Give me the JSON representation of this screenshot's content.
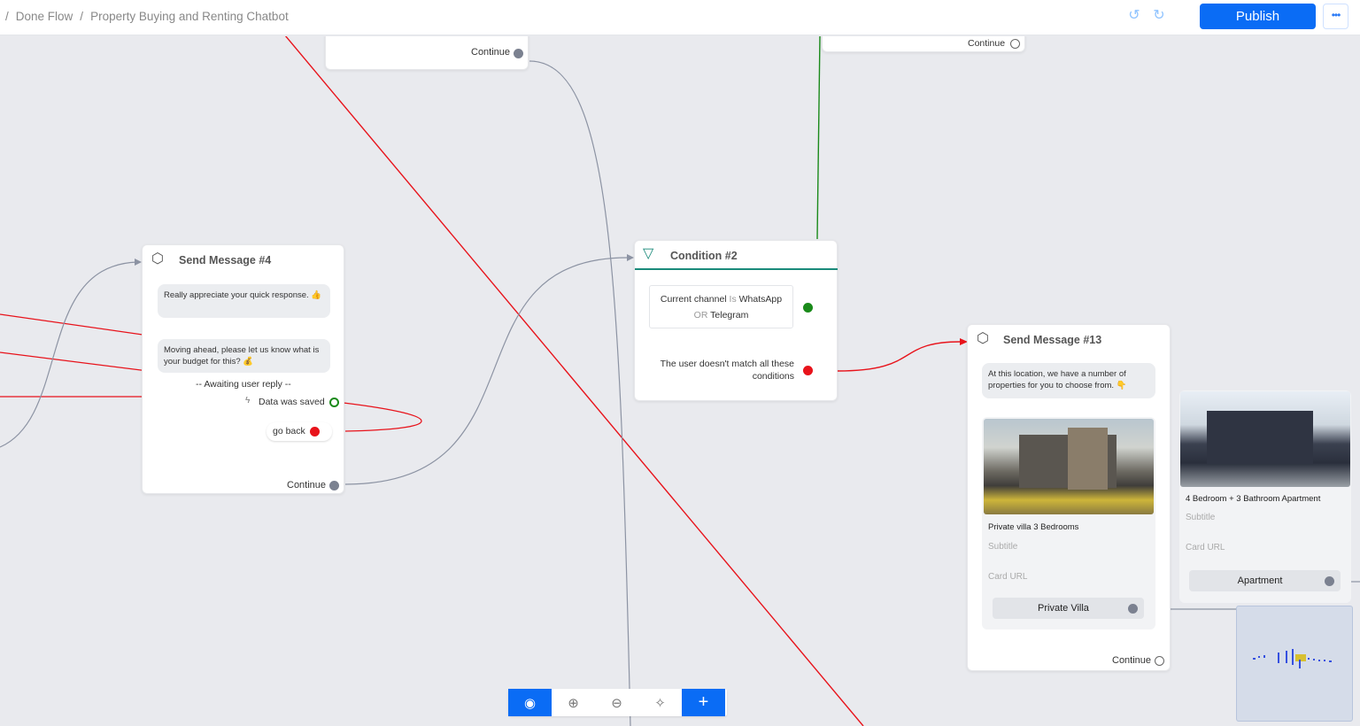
{
  "breadcrumb": {
    "separator": "/",
    "items": [
      "Done Flow",
      "Property Buying and Renting Chatbot"
    ]
  },
  "toolbar_top": {
    "undo_icon": "undo-icon",
    "redo_icon": "redo-icon",
    "publish_label": "Publish",
    "more_label": "•••"
  },
  "colors": {
    "accent": "#0a6cf5",
    "edge_gray": "#8c93a3",
    "edge_red": "#e8131b",
    "edge_green": "#1a8a1a",
    "condition_accent": "#1a8a7a"
  },
  "top_node_left": {
    "continue_label": "Continue"
  },
  "top_node_right": {
    "continue_label": "Continue"
  },
  "send_message_4": {
    "title": "Send Message #4",
    "bubble1": "Really appreciate your quick response. 👍",
    "bubble2": "Moving ahead, please let us know what is your budget for this? 💰",
    "awaiting": "-- Awaiting user reply --",
    "data_saved": "Data was saved",
    "go_back": "go back",
    "continue_label": "Continue"
  },
  "condition_2": {
    "title": "Condition #2",
    "rule_part1": "Current channel",
    "rule_op": "Is",
    "rule_value1": "WhatsApp",
    "rule_or": "OR",
    "rule_value2": "Telegram",
    "else_label": "The user doesn't match all these conditions"
  },
  "send_message_13": {
    "title": "Send Message #13",
    "bubble": "At this location, we have a number of properties for you to choose from. 👇",
    "card1": {
      "title": "Private villa 3 Bedrooms",
      "subtitle": "Subtitle",
      "url": "Card URL",
      "button": "Private Villa"
    },
    "card2": {
      "title": "4 Bedroom + 3 Bathroom Apartment",
      "subtitle": "Subtitle",
      "url": "Card URL",
      "button": "Apartment"
    },
    "continue_label": "Continue"
  },
  "canvas_toolbar": [
    "preview-eye-icon",
    "zoom-in-icon",
    "zoom-out-icon",
    "auto-layout-sparkle-icon",
    "add-node-plus-icon"
  ]
}
